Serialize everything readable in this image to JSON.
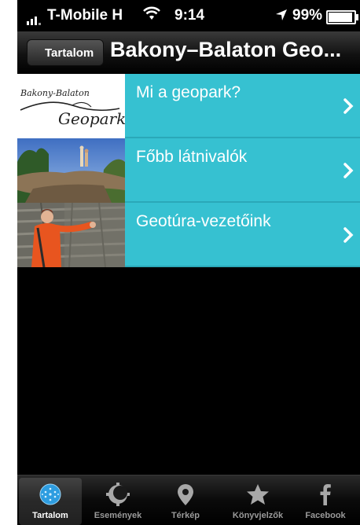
{
  "status_bar": {
    "carrier": "T-Mobile H",
    "time": "9:14",
    "battery": "99%"
  },
  "nav": {
    "back_label": "Tartalom",
    "title": "Bakony–Balaton Geo..."
  },
  "menu": {
    "items": [
      {
        "label": "Mi a geopark?",
        "thumb_logo_top": "Bakony-Balaton",
        "thumb_logo_bottom": "Geopark"
      },
      {
        "label": "Főbb látnivalók"
      },
      {
        "label": "Geotúra-vezetőink"
      }
    ]
  },
  "tabbar": {
    "tabs": [
      {
        "label": "Tartalom",
        "icon": "globe-icon",
        "active": true
      },
      {
        "label": "Események",
        "icon": "gear-moon-icon",
        "active": false
      },
      {
        "label": "Térkép",
        "icon": "map-pin-icon",
        "active": false
      },
      {
        "label": "Könyvjelzők",
        "icon": "star-icon",
        "active": false
      },
      {
        "label": "Facebook",
        "icon": "facebook-icon",
        "active": false
      }
    ]
  },
  "colors": {
    "accent": "#36c1d1",
    "active_tab_icon": "#2e9de0"
  }
}
